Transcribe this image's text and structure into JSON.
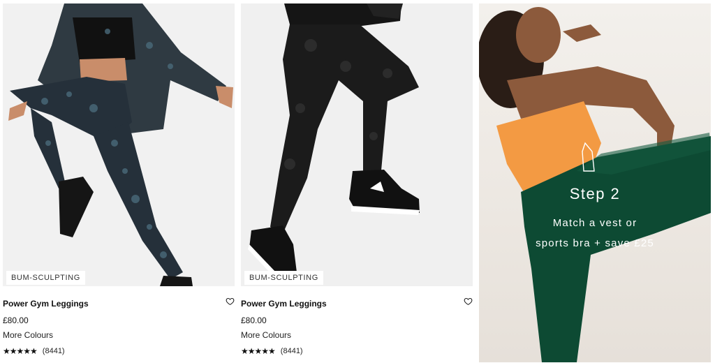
{
  "products": [
    {
      "badge": "BUM-SCULPTING",
      "name": "Power Gym Leggings",
      "price": "£80.00",
      "colours": "More Colours",
      "stars": "★★★★★",
      "review_count": "(8441)"
    },
    {
      "badge": "BUM-SCULPTING",
      "name": "Power Gym Leggings",
      "price": "£80.00",
      "colours": "More Colours",
      "stars": "★★★★★",
      "review_count": "(8441)"
    }
  ],
  "promo": {
    "step": "Step 2",
    "line1": "Match a vest or",
    "line2": "sports bra + save £25"
  },
  "colors": {
    "orange_top": "#f39a43",
    "green_leggings": "#0d4a33",
    "black_leggings": "#1b1b1b",
    "print_leggings": "#25303a"
  }
}
